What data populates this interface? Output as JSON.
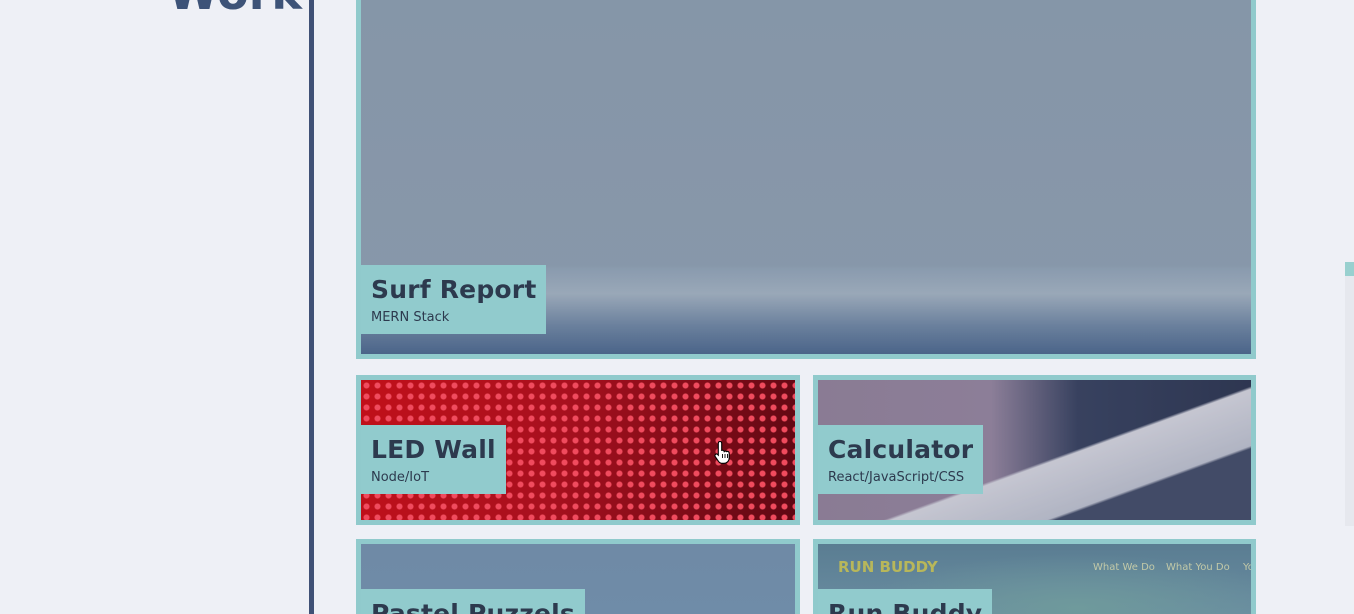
{
  "sidebar": {
    "heading": "Work"
  },
  "projects": [
    {
      "title": "Surf Report",
      "stack": "MERN Stack"
    },
    {
      "title": "LED Wall",
      "stack": "Node/IoT"
    },
    {
      "title": "Calculator",
      "stack": "React/JavaScript/CSS"
    },
    {
      "title": "Pastel Puzzels",
      "stack": ""
    },
    {
      "title": "Run Buddy",
      "stack": ""
    }
  ],
  "run_buddy_preview": {
    "brand": "RUN BUDDY",
    "nav": [
      "What We Do",
      "What You Do",
      "Yo"
    ]
  },
  "colors": {
    "accent": "#90cacc",
    "divider": "#3f5176",
    "label_text": "#2d3a4e",
    "page_bg": "#eef0f6"
  },
  "icons": {
    "cursor": "hand-pointer-icon"
  }
}
